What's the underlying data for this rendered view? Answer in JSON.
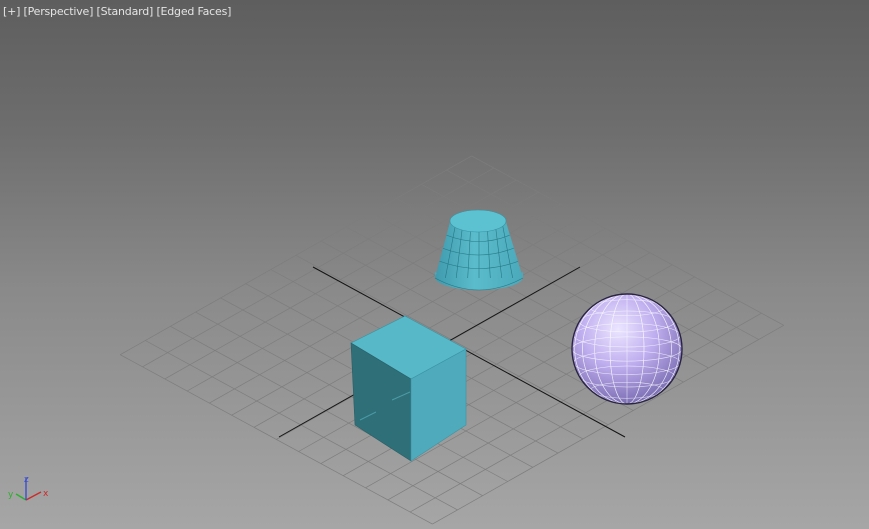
{
  "viewport": {
    "labels": {
      "plus": "[+]",
      "view": "[Perspective]",
      "shading": "[Standard]",
      "display": "[Edged Faces]"
    }
  },
  "objects": [
    {
      "type": "box",
      "color": "#5ab9c9"
    },
    {
      "type": "cone",
      "color": "#5ab9c9"
    },
    {
      "type": "sphere",
      "color": "#b7a4e8"
    }
  ],
  "axis_gizmo": {
    "x": "x",
    "y": "y",
    "z": "z"
  },
  "colors": {
    "axis_x": "#cc2a2a",
    "axis_y": "#2bb02b",
    "axis_z": "#3a4fd0",
    "grid": "#7d7d7d",
    "grid_axis": "#141414"
  }
}
